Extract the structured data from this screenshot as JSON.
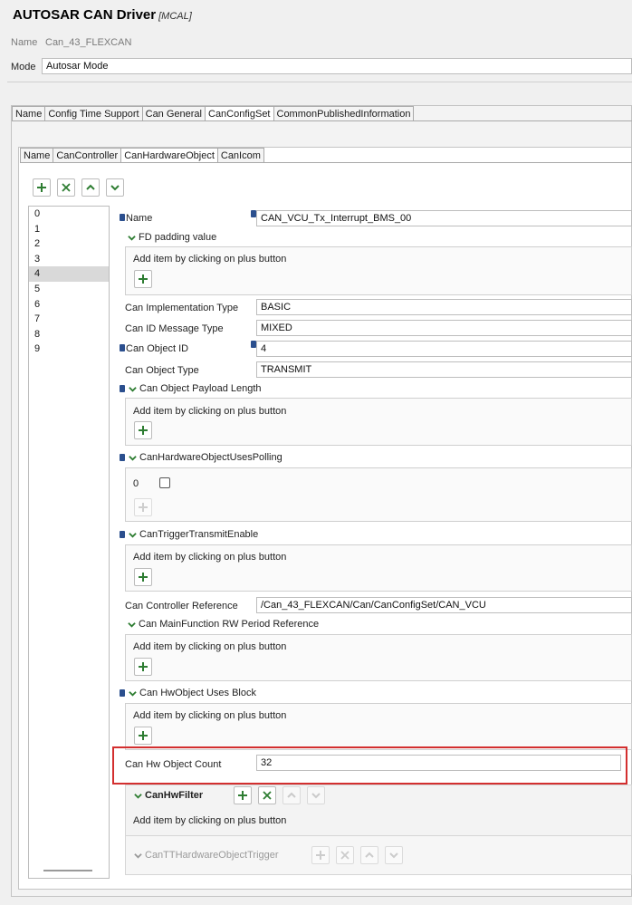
{
  "header": {
    "title": "AUTOSAR CAN Driver",
    "subtitle": "[MCAL]"
  },
  "name_row": {
    "label": "Name",
    "value": "Can_43_FLEXCAN"
  },
  "mode_row": {
    "label": "Mode",
    "value": "Autosar Mode"
  },
  "top_tabs": [
    "Name",
    "Config Time Support",
    "Can General",
    "CanConfigSet",
    "CommonPublishedInformation"
  ],
  "inner_tabs": [
    "Name",
    "CanController",
    "CanHardwareObject",
    "CanIcom"
  ],
  "list": {
    "items": [
      "0",
      "1",
      "2",
      "3",
      "4",
      "5",
      "6",
      "7",
      "8",
      "9"
    ],
    "selected": "4"
  },
  "form": {
    "name_label": "Name",
    "name_value": "CAN_VCU_Tx_Interrupt_BMS_00",
    "fd_padding": "FD padding value",
    "add_hint": "Add item by clicking on plus button",
    "impl_type_label": "Can Implementation Type",
    "impl_type_value": "BASIC",
    "id_msg_label": "Can ID Message Type",
    "id_msg_value": "MIXED",
    "obj_id_label": "Can Object ID",
    "obj_id_value": "4",
    "obj_type_label": "Can Object Type",
    "obj_type_value": "TRANSMIT",
    "payload_label": "Can Object Payload Length",
    "polling_label": "CanHardwareObjectUsesPolling",
    "polling_value": "0",
    "trigger_label": "CanTriggerTransmitEnable",
    "ctrl_ref_label": "Can Controller Reference",
    "ctrl_ref_value": "/Can_43_FLEXCAN/Can/CanConfigSet/CAN_VCU",
    "mainfn_label": "Can MainFunction RW Period Reference",
    "uses_block_label": "Can HwObject Uses Block",
    "hw_count_label": "Can Hw Object Count",
    "hw_count_value": "32",
    "hw_filter_label": "CanHwFilter",
    "tt_trigger_label": "CanTTHardwareObjectTrigger"
  },
  "colors": {
    "highlight": "#d32f2f",
    "plus": "#2e7d32",
    "accent": "#2b4f8e"
  }
}
